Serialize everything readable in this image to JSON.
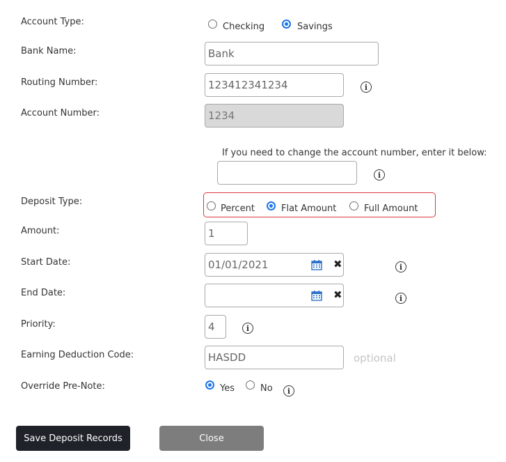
{
  "form": {
    "account_type": {
      "label": "Account Type:",
      "options": [
        "Checking",
        "Savings"
      ],
      "selected": "Savings"
    },
    "bank_name": {
      "label": "Bank Name:",
      "value": "Bank"
    },
    "routing_number": {
      "label": "Routing Number:",
      "value": "123412341234"
    },
    "account_number": {
      "label": "Account Number:",
      "value": "1234"
    },
    "change_account": {
      "hint": "If you need to change the account number, enter it below:",
      "value": ""
    },
    "deposit_type": {
      "label": "Deposit Type:",
      "options": [
        "Percent",
        "Flat Amount",
        "Full Amount"
      ],
      "selected": "Flat Amount"
    },
    "amount": {
      "label": "Amount:",
      "value": "1"
    },
    "start_date": {
      "label": "Start Date:",
      "value": "01/01/2021"
    },
    "end_date": {
      "label": "End Date:",
      "value": ""
    },
    "priority": {
      "label": "Priority:",
      "value": "4"
    },
    "earning_deduction_code": {
      "label": "Earning Deduction Code:",
      "value": "HASDD",
      "note": "optional"
    },
    "override_prenote": {
      "label": "Override Pre-Note:",
      "options": [
        "Yes",
        "No"
      ],
      "selected": "Yes"
    }
  },
  "icons": {
    "info": "info-icon",
    "calendar": "calendar-icon",
    "clear": "clear-icon"
  },
  "buttons": {
    "save": "Save Deposit Records",
    "close": "Close"
  },
  "colors": {
    "accent": "#1a73e8",
    "error_border": "#d9363e",
    "save_bg": "#1f2329",
    "close_bg": "#7d7d7d",
    "disabled_bg": "#d9d9d9"
  }
}
